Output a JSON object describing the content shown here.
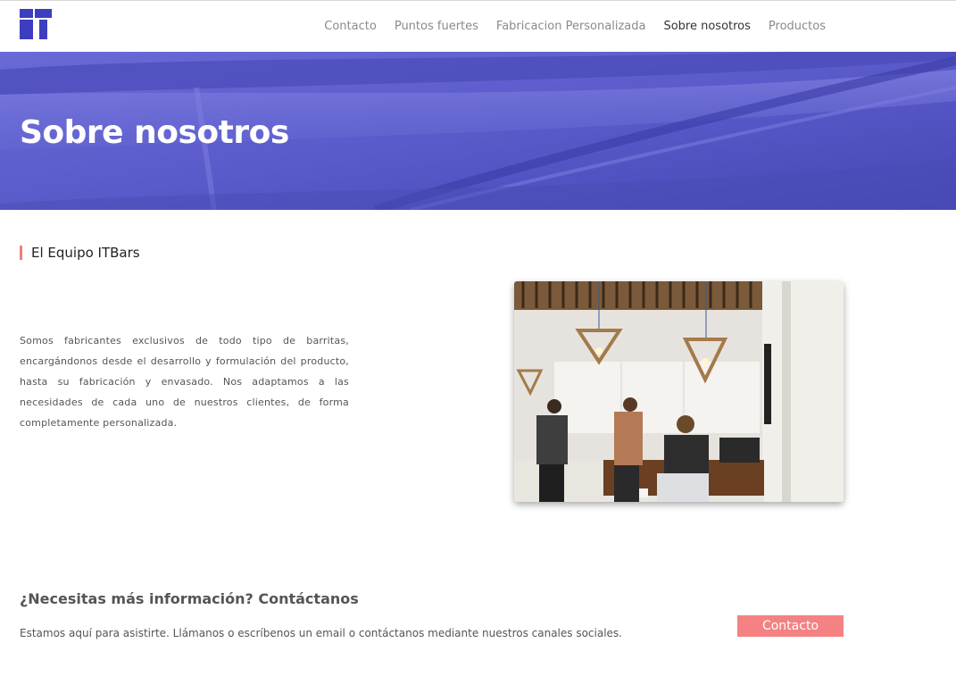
{
  "brand": {
    "logo_name": "itbars-logo",
    "accent_color": "#3d3dbf"
  },
  "nav": {
    "items": [
      {
        "label": "Contacto",
        "active": false
      },
      {
        "label": "Puntos fuertes",
        "active": false
      },
      {
        "label": "Fabricacion Personalizada",
        "active": false
      },
      {
        "label": "Sobre nosotros",
        "active": true
      },
      {
        "label": "Productos",
        "active": false
      }
    ]
  },
  "hero": {
    "title": "Sobre nosotros",
    "overlay_color": "#5b5bc9"
  },
  "team": {
    "heading": "El Equipo ITBars",
    "heading_marker_color": "#f47c7c",
    "description": "Somos fabricantes exclusivos de todo tipo de barritas, encargándonos desde el desarrollo y formulación del producto, hasta su fabricación y envasado. Nos adaptamos a las necesidades de cada uno de nuestros clientes, de forma completamente personalizada."
  },
  "contact_cta": {
    "title": "¿Necesitas más información? Contáctanos",
    "text": "Estamos aquí para asistirte. Llámanos o escríbenos un email o contáctanos mediante nuestros canales sociales.",
    "button_label": "Contacto",
    "button_color": "#f48282"
  }
}
